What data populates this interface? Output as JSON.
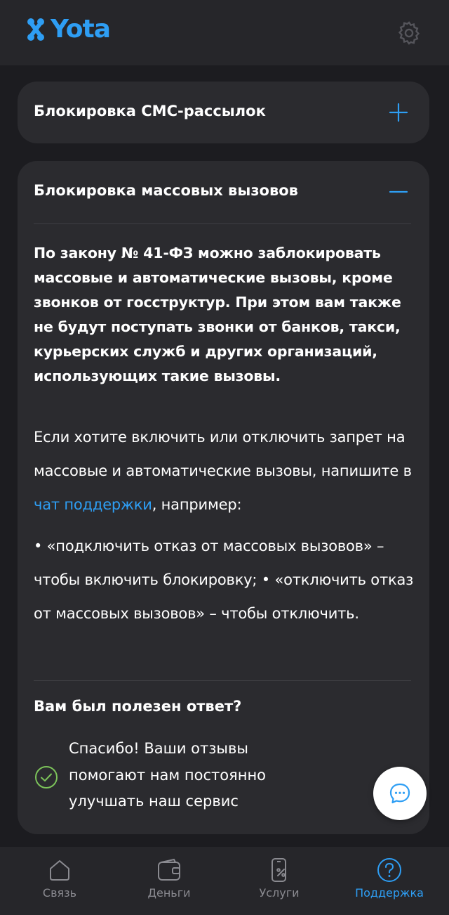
{
  "header": {
    "logo_text": "Yota",
    "logo_icon": "yota-logo-icon",
    "settings_icon": "gear-icon"
  },
  "accordion": [
    {
      "title": "Блокировка СМС-рассылок",
      "state": "collapsed",
      "toggle_icon": "plus-icon"
    },
    {
      "title": "Блокировка массовых вызовов",
      "state": "expanded",
      "toggle_icon": "minus-icon",
      "bold_text": "По закону № 41-ФЗ можно заблокировать массовые и автоматические вызовы, кроме звонков от госструктур. При этом вам также не будут поступать звонки от банков, такси, курьерских служб и других организаций, использующих такие вызовы.",
      "para_before_link": "Если хотите включить или отключить запрет на массовые и автоматические вызовы, напишите в ",
      "link_text": "чат поддержки",
      "para_after_link": ", например:",
      "bullets_text": "• «подключить отказ от массовых вызовов» – чтобы включить блокировку; • «отключить отказ от массовых вызовов» – чтобы отключить.",
      "bullet1": "• «подключить отказ от массовых вызовов» – чтобы включить блокировку;",
      "bullet2": "• «отключить отказ от массовых вызовов» – чтобы отключить.",
      "feedback_question": "Вам был полезен ответ?",
      "feedback_thanks": "Спасибо! Ваши отзывы помогают нам постоянно улучшать наш сервис",
      "feedback_icon": "check-circle-icon"
    }
  ],
  "chat_fab_icon": "chat-bubble-icon",
  "bottom_nav": [
    {
      "label": "Связь",
      "icon": "home-icon",
      "active": false
    },
    {
      "label": "Деньги",
      "icon": "wallet-icon",
      "active": false
    },
    {
      "label": "Услуги",
      "icon": "services-icon",
      "active": false
    },
    {
      "label": "Поддержка",
      "icon": "question-circle-icon",
      "active": true
    }
  ],
  "colors": {
    "accent": "#2e9ef4",
    "background": "#1c1c20",
    "card": "#2b2b2f",
    "bar": "#26262a",
    "inactive": "#8a8a90",
    "success": "#7cc35a"
  }
}
